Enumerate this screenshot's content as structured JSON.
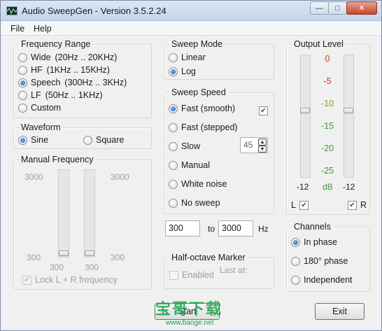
{
  "window": {
    "title": "Audio SweepGen - Version 3.5.2.24",
    "minimize": "—",
    "maximize": "□",
    "close": "✕"
  },
  "menu": {
    "file": "File",
    "help": "Help"
  },
  "frequency_range": {
    "label": "Frequency Range",
    "options": [
      {
        "name": "Wide",
        "range": "(20Hz .. 20KHz)",
        "selected": false
      },
      {
        "name": "HF",
        "range": "(1KHz .. 15KHz)",
        "selected": false
      },
      {
        "name": "Speech",
        "range": "(300Hz .. 3KHz)",
        "selected": true
      },
      {
        "name": "LF",
        "range": "(50Hz .. 1KHz)",
        "selected": false
      },
      {
        "name": "Custom",
        "range": "",
        "selected": false
      }
    ]
  },
  "waveform": {
    "label": "Waveform",
    "sine": "Sine",
    "square": "Square",
    "selected": "sine"
  },
  "manual_frequency": {
    "label": "Manual Frequency",
    "left_top": "3000",
    "left_bottom": "300",
    "right_top": "3000",
    "right_bottom": "300",
    "slider_l_value": "300",
    "slider_r_value": "300",
    "lock_label": "Lock L + R frequency",
    "lock_checked": true
  },
  "sweep_mode": {
    "label": "Sweep Mode",
    "linear": "Linear",
    "log": "Log",
    "selected": "log"
  },
  "sweep_speed": {
    "label": "Sweep Speed",
    "options": [
      "Fast (smooth)",
      "Fast (stepped)",
      "Slow",
      "Manual",
      "White noise",
      "No sweep"
    ],
    "selected_index": 0,
    "fast_check": true,
    "slow_value": "45"
  },
  "frequency_inputs": {
    "from": "300",
    "to_label": "to",
    "to": "3000",
    "unit": "Hz"
  },
  "half_octave": {
    "label": "Half-octave Marker",
    "enabled_label": "Enabled",
    "last_at": "Last at:"
  },
  "output_level": {
    "label": "Output Level",
    "scale": [
      "0",
      "-5",
      "-10",
      "-15",
      "-20",
      "-25"
    ],
    "scale_colors": [
      "#e0301e",
      "#e0301e",
      "#8a9a1a",
      "#3a9a3a",
      "#3a9a3a",
      "#3a9a3a"
    ],
    "left_value": "-12",
    "unit": "dB",
    "right_value": "-12",
    "l_label": "L",
    "r_label": "R",
    "l_checked": true,
    "r_checked": true
  },
  "channels": {
    "label": "Channels",
    "options": [
      "In phase",
      "180° phase",
      "Independent"
    ],
    "selected_index": 0
  },
  "buttons": {
    "start": "Start",
    "exit": "Exit"
  },
  "watermark": {
    "text": "宝哥下载",
    "url": "www.baoge.net"
  }
}
